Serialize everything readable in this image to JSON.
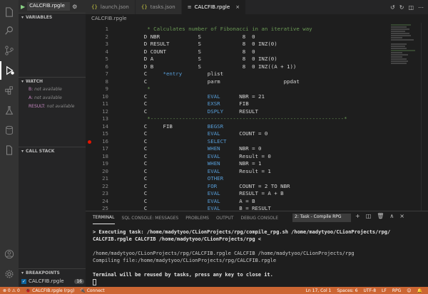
{
  "debug": {
    "config": "CALCFIB.rpgle",
    "sections": {
      "variables": "VARIABLES",
      "watch": "WATCH",
      "call_stack": "CALL STACK",
      "breakpoints": "BREAKPOINTS"
    },
    "watch": [
      {
        "name": "B:",
        "value": "not available"
      },
      {
        "name": "A:",
        "value": "not available"
      },
      {
        "name": "RESULT:",
        "value": "not available"
      }
    ],
    "breakpoint": {
      "file": "CALCFIB.rpgle",
      "count": "16"
    }
  },
  "tabs": [
    {
      "label": "launch.json",
      "icon": "{}"
    },
    {
      "label": "tasks.json",
      "icon": "{}"
    },
    {
      "label": "CALCFIB.rpgle",
      "icon": "≡"
    }
  ],
  "breadcrumb": "CALCFIB.rpgle",
  "code": [
    {
      "n": "1",
      "text": "     * Calculates number of Fibonacci in an iterative way"
    },
    {
      "n": "2",
      "text": "    D NBR            S             8  0"
    },
    {
      "n": "3",
      "text": "    D RESULT         S             8  0 INZ(0)"
    },
    {
      "n": "4",
      "text": "    D COUNT          S             8  0"
    },
    {
      "n": "5",
      "text": "    D A              S             8  0 INZ(0)"
    },
    {
      "n": "6",
      "text": "    D B              S             8  0 INZ((A + 1))"
    },
    {
      "n": "7",
      "text": "    C     *entry        plist"
    },
    {
      "n": "8",
      "text": "    C                   parm                    ppdat"
    },
    {
      "n": "9",
      "text": "     *"
    },
    {
      "n": "10",
      "text": "    C                   EVAL      NBR = 21"
    },
    {
      "n": "11",
      "text": "    C                   EXSR      FIB"
    },
    {
      "n": "12",
      "text": "    C                   DSPLY     RESULT"
    },
    {
      "n": "13",
      "text": "     *-------------------------------------------------------------*"
    },
    {
      "n": "14",
      "text": "    C     FIB           BEGSR"
    },
    {
      "n": "15",
      "text": "    C                   EVAL      COUNT = 0"
    },
    {
      "n": "16",
      "text": "    C                   SELECT"
    },
    {
      "n": "17",
      "text": "    C                   WHEN      NBR = 0"
    },
    {
      "n": "18",
      "text": "    C                   EVAL      Result = 0"
    },
    {
      "n": "19",
      "text": "    C                   WHEN      NBR = 1"
    },
    {
      "n": "20",
      "text": "    C                   EVAL      Result = 1"
    },
    {
      "n": "21",
      "text": "    C                   OTHER"
    },
    {
      "n": "22",
      "text": "    C                   FOR       COUNT = 2 TO NBR"
    },
    {
      "n": "23",
      "text": "    C                   EVAL      RESULT = A + B"
    },
    {
      "n": "24",
      "text": "    C                   EVAL      A = B"
    },
    {
      "n": "25",
      "text": "    C                   EVAL      B = RESULT"
    }
  ],
  "breakpoint_lines": [
    "16"
  ],
  "panel": {
    "tabs": [
      "TERMINAL",
      "SQL CONSOLE: MESSAGES",
      "PROBLEMS",
      "OUTPUT",
      "DEBUG CONSOLE"
    ],
    "task": "2: Task - Compile RPG",
    "terminal": [
      {
        "text": "> Executing task: /home/madytyoo/CLionProjects/rpg/compile_rpg.sh /home/madytyoo/CLionProjects/rpg/",
        "bold": true
      },
      {
        "text": "CALCFIB.rpgle CALCFIB /home/madytyoo/CLionProjects/rpg <",
        "bold": true
      },
      {
        "text": "",
        "bold": false
      },
      {
        "text": "/home/madytyoo/CLionProjects/rpg/CALCFIB.rpgle CALCFIB /home/madytyoo/CLionProjects/rpg",
        "bold": false
      },
      {
        "text": "Compiling file:/home/madytyoo/CLionProjects/rpg/CALCFIB.rpgle",
        "bold": false
      },
      {
        "text": "",
        "bold": false
      },
      {
        "text": "Terminal will be reused by tasks, press any key to close it.",
        "bold": true
      }
    ]
  },
  "status": {
    "file": "CALCFIB.rpgle (rpg)",
    "connect": "Connect",
    "position": "Ln 17, Col 1",
    "spaces": "Spaces: 6",
    "encoding": "UTF-8",
    "eol": "LF",
    "language": "RPG"
  },
  "colors": {
    "status_bar": "#cc6633",
    "breakpoint": "#e51400",
    "keyword": "#569cd6",
    "comment": "#6a9955"
  }
}
